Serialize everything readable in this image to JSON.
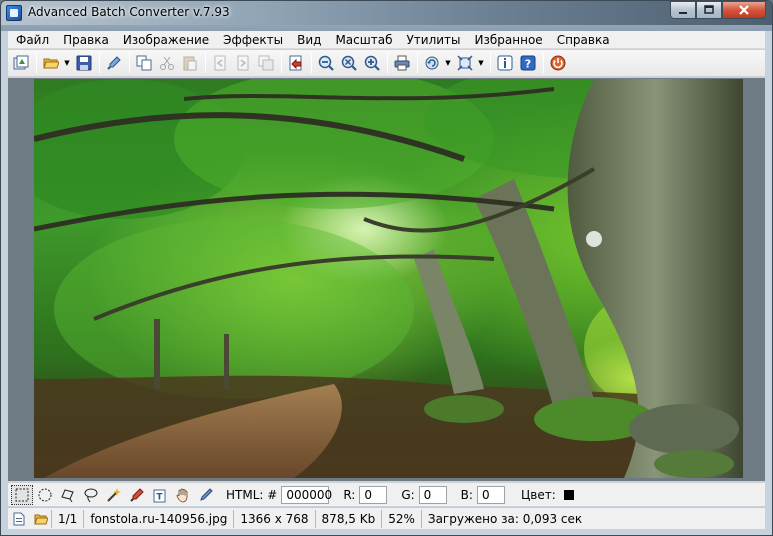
{
  "window": {
    "title": "Advanced Batch Converter v.7.93"
  },
  "menu": {
    "items": [
      "Файл",
      "Правка",
      "Изображение",
      "Эффекты",
      "Вид",
      "Масштаб",
      "Утилиты",
      "Избранное",
      "Справка"
    ]
  },
  "toolbar": {
    "buttons": [
      {
        "name": "batch-convert",
        "icon": "batch-icon",
        "enabled": true
      },
      {
        "name": "open",
        "icon": "folder-open-icon",
        "enabled": true,
        "dropdown": true
      },
      {
        "name": "save",
        "icon": "save-icon",
        "enabled": true
      },
      {
        "name": "properties",
        "icon": "pipette-icon",
        "enabled": true
      },
      {
        "name": "copy",
        "icon": "copy-icon",
        "enabled": true
      },
      {
        "name": "cut",
        "icon": "scissors-icon",
        "enabled": false
      },
      {
        "name": "paste",
        "icon": "paste-icon",
        "enabled": false
      },
      {
        "name": "prev-page",
        "icon": "page-back-icon",
        "enabled": false
      },
      {
        "name": "next-page",
        "icon": "page-forward-icon",
        "enabled": false
      },
      {
        "name": "duplicate",
        "icon": "duplicate-icon",
        "enabled": false
      },
      {
        "name": "convert",
        "icon": "convert-icon",
        "enabled": true
      },
      {
        "name": "zoom-out",
        "icon": "zoom-out-icon",
        "enabled": true
      },
      {
        "name": "zoom-fit",
        "icon": "zoom-fit-icon",
        "enabled": true
      },
      {
        "name": "zoom-in",
        "icon": "zoom-in-icon",
        "enabled": true
      },
      {
        "name": "print",
        "icon": "printer-icon",
        "enabled": true
      },
      {
        "name": "rotate",
        "icon": "rotate-icon",
        "enabled": true,
        "dropdown": true
      },
      {
        "name": "resize",
        "icon": "resize-icon",
        "enabled": true,
        "dropdown": true
      },
      {
        "name": "info",
        "icon": "info-icon",
        "enabled": true
      },
      {
        "name": "help",
        "icon": "help-icon",
        "enabled": true
      },
      {
        "name": "exit",
        "icon": "power-icon",
        "enabled": true
      }
    ]
  },
  "tools": {
    "items": [
      "rect-select-icon",
      "ellipse-select-icon",
      "polygon-lasso-icon",
      "lasso-icon",
      "magic-wand-icon",
      "eyedropper-icon",
      "text-tool-icon",
      "hand-icon",
      "pen-icon"
    ],
    "html_label": "HTML: #",
    "html_value": "000000",
    "r_label": "R:",
    "r_value": "0",
    "g_label": "G:",
    "g_value": "0",
    "b_label": "B:",
    "b_value": "0",
    "color_label": "Цвет:",
    "color_value": "#000000"
  },
  "status": {
    "page": "1/1",
    "filename": "fonstola.ru-140956.jpg",
    "dimensions": "1366 x 768",
    "filesize": "878,5 Kb",
    "zoom": "52%",
    "load_time": "Загружено за: 0,093 сек"
  },
  "colors": {
    "titlebar": "#8fa3b5",
    "canvas_bg": "#6f7b84",
    "close_btn": "#d4553b"
  }
}
